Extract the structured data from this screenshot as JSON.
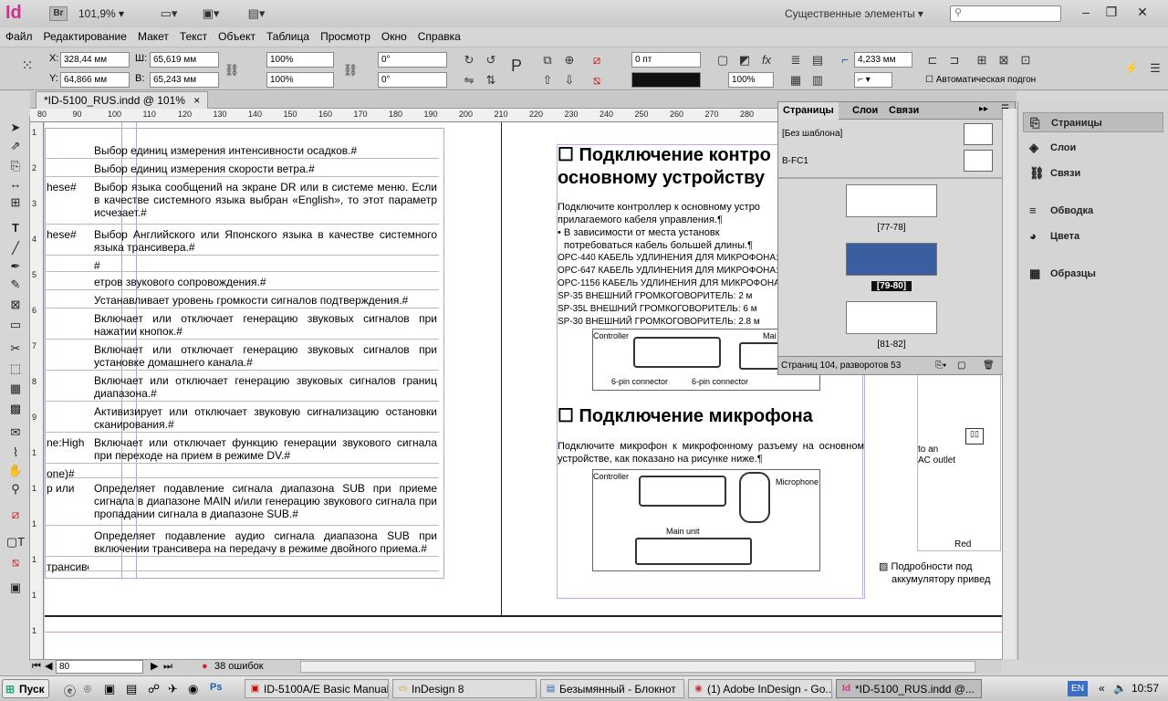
{
  "app": {
    "logo": "Id",
    "bridge": "Br",
    "zoom": "101,9%",
    "workspace": "Существенные элементы",
    "search_placeholder": ""
  },
  "menu": [
    "Файл",
    "Редактирование",
    "Макет",
    "Текст",
    "Объект",
    "Таблица",
    "Просмотр",
    "Окно",
    "Справка"
  ],
  "control": {
    "x_label": "X:",
    "x_value": "328,44 мм",
    "y_label": "Y:",
    "y_value": "64,866 мм",
    "w_label": "Ш:",
    "w_value": "65,619 мм",
    "h_label": "В:",
    "h_value": "65,243 мм",
    "scale_x": "100%",
    "scale_y": "100%",
    "angle": "0°",
    "shear": "0°",
    "stroke_weight": "0 пт",
    "opacity": "100%",
    "offset": "4,233 мм",
    "autofit": "Автоматическая подгон"
  },
  "doc_tab": {
    "title": "*ID-5100_RUS.indd @ 101%",
    "close": "×"
  },
  "ruler_h": [
    "80",
    "90",
    "100",
    "110",
    "120",
    "130",
    "140",
    "150",
    "160",
    "170",
    "180",
    "190",
    "200",
    "210",
    "220",
    "230",
    "240",
    "250",
    "260",
    "270",
    "280"
  ],
  "ruler_v": [
    "1",
    "2",
    "3",
    "4",
    "5",
    "6",
    "7",
    "8",
    "9",
    "1",
    "1",
    "1",
    "1",
    "1",
    "1"
  ],
  "left_table": [
    {
      "l": "",
      "r": "Выбор единиц измерения интенсивности осадков.#"
    },
    {
      "l": "",
      "r": "Выбор единиц измерения скорости ветра.#"
    },
    {
      "l": "hese#",
      "r": "Выбор языка сообщений на экране DR или в системе меню. Если в качестве системного языка выбран «English», то этот параметр исчезает.#"
    },
    {
      "l": "hese#",
      "r": "Выбор Английского или Японского языка в качестве системного языка трансивера.#"
    },
    {
      "l": "",
      "r": "#"
    },
    {
      "l": "",
      "r": "етров звукового сопровождения.#"
    },
    {
      "l": "",
      "r": "Устанавливает уровень громкости сигналов подтверждения.#"
    },
    {
      "l": "",
      "r": "Включает или отключает генерацию звуковых сигналов при нажатии кнопок.#"
    },
    {
      "l": "",
      "r": "Включает или отключает генерацию звуковых сигналов при установке домашнего канала.#"
    },
    {
      "l": "",
      "r": "Включает или отключает генерацию звуковых сигналов границ диапазона.#"
    },
    {
      "l": "",
      "r": "Активизирует или отключает звуковую сигнализацию остановки сканирования.#"
    },
    {
      "l": "ne:High",
      "r": "Включает или отключает функцию генерации звукового сигнала при переходе на прием в режиме DV.#"
    },
    {
      "l": "one)#",
      "r": ""
    },
    {
      "l": "р или",
      "r": "Определяет подавление сигнала диапазона SUB при приеме сигнала в диапазоне MAIN и/или генерацию звукового сигнала при пропадании сигнала в диапазоне SUB.#"
    },
    {
      "l": "",
      "r": "Определяет подавление аудио сигнала диапазона SUB при включении трансивера на передачу в режиме двойного приема.#"
    },
    {
      "l": "трансивера.#",
      "r": ""
    }
  ],
  "right_page": {
    "heading1": "Подключение контро",
    "heading1b": "основному устройству",
    "para1": "Подключите контроллер к основному устро",
    "para1b": "прилагаемого кабеля управления.¶",
    "bullet": "В   зависимости   от   места   установк",
    "bulletb": "потребоваться кабель большей длины.¶",
    "items": [
      "OPC-440 КАБЕЛЬ УДЛИНЕНИЯ ДЛЯ МИКРОФОНА:",
      "OPC-647 КАБЕЛЬ УДЛИНЕНИЯ ДЛЯ МИКРОФОНА:",
      "OPC-1156 КАБЕЛЬ УДЛИНЕНИЯ ДЛЯ МИКРОФОНА:",
      "SP-35 ВНЕШНИЙ ГРОМКОГОВОРИТЕЛЬ:   2 м",
      "SP-35L ВНЕШНИЙ ГРОМКОГОВОРИТЕЛЬ:   6 м",
      "SP-30 ВНЕШНИЙ ГРОМКОГОВОРИТЕЛЬ:   2.8 м"
    ],
    "diag1": {
      "controller": "Controller",
      "main": "Mai",
      "c1": "6-pin connector",
      "c2": "6-pin connector"
    },
    "heading2": "Подключение микрофона",
    "para2": "Подключите микрофон к микрофонному разъему на основном устройстве, как показано на рисунке ниже.¶",
    "diag2": {
      "controller": "Controller",
      "microphone": "Microphone",
      "main": "Main unit"
    },
    "side": {
      "ac1": "to an",
      "ac2": "AC outlet",
      "red": "Red",
      "note1": "Подробности   под",
      "note2": "аккумулятору привед"
    }
  },
  "pages_panel": {
    "tabs": [
      "Страницы",
      "Слои",
      "Связи"
    ],
    "masters": [
      {
        "name": "[Без шаблона]"
      },
      {
        "name": "B-FC1"
      }
    ],
    "spreads": [
      {
        "label": "[77-78]"
      },
      {
        "label": "[79-80]"
      },
      {
        "label": "[81-82]"
      }
    ],
    "footer": "Страниц 104, разворотов 53"
  },
  "right_dock": [
    "Страницы",
    "Слои",
    "Связи",
    "Обводка",
    "Цвета",
    "Образцы"
  ],
  "status": {
    "page": "80",
    "errors": "38 ошибок"
  },
  "taskbar": {
    "start": "Пуск",
    "tasks": [
      "ID-5100A/E Basic Manual...",
      "InDesign 8",
      "Безымянный - Блокнот",
      "(1) Adobe InDesign - Go...",
      "*ID-5100_RUS.indd @..."
    ],
    "lang": "EN",
    "time": "10:57"
  },
  "colors": {
    "accent": "#d0308c",
    "selection": "#3a5fa0"
  }
}
